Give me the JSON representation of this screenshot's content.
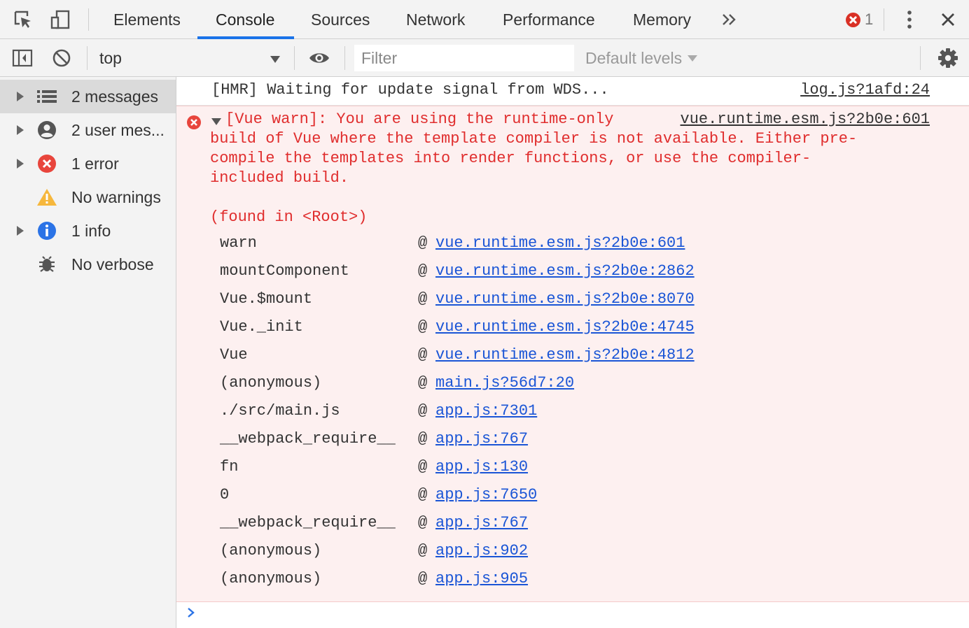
{
  "tabs": [
    {
      "label": "Elements"
    },
    {
      "label": "Console"
    },
    {
      "label": "Sources"
    },
    {
      "label": "Network"
    },
    {
      "label": "Performance"
    },
    {
      "label": "Memory"
    }
  ],
  "active_tab": "Console",
  "error_count": "1",
  "toolbar": {
    "context": "top",
    "filter_placeholder": "Filter",
    "levels": "Default levels"
  },
  "sidebar": {
    "items": [
      {
        "label": "2 messages",
        "icon": "list-icon"
      },
      {
        "label": "2 user mes...",
        "icon": "user-icon"
      },
      {
        "label": "1 error",
        "icon": "error-icon"
      },
      {
        "label": "No warnings",
        "icon": "warning-icon"
      },
      {
        "label": "1 info",
        "icon": "info-icon"
      },
      {
        "label": "No verbose",
        "icon": "bug-icon"
      }
    ]
  },
  "console": {
    "log": {
      "text": "[HMR] Waiting for update signal from WDS...",
      "source": "log.js?1afd:24"
    },
    "error": {
      "lines": [
        "[Vue warn]: You are using the runtime-only",
        "build of Vue where the template compiler is not available. Either pre-",
        "compile the templates into render functions, or use the compiler-",
        "included build."
      ],
      "found_in": "(found in <Root>)",
      "source": "vue.runtime.esm.js?2b0e:601",
      "stack": [
        {
          "fn": "warn",
          "link": "vue.runtime.esm.js?2b0e:601"
        },
        {
          "fn": "mountComponent",
          "link": "vue.runtime.esm.js?2b0e:2862"
        },
        {
          "fn": "Vue.$mount",
          "link": "vue.runtime.esm.js?2b0e:8070"
        },
        {
          "fn": "Vue._init",
          "link": "vue.runtime.esm.js?2b0e:4745"
        },
        {
          "fn": "Vue",
          "link": "vue.runtime.esm.js?2b0e:4812"
        },
        {
          "fn": "(anonymous)",
          "link": "main.js?56d7:20"
        },
        {
          "fn": "./src/main.js",
          "link": "app.js:7301"
        },
        {
          "fn": "__webpack_require__",
          "link": "app.js:767"
        },
        {
          "fn": "fn",
          "link": "app.js:130"
        },
        {
          "fn": "0",
          "link": "app.js:7650"
        },
        {
          "fn": "__webpack_require__",
          "link": "app.js:767"
        },
        {
          "fn": "(anonymous)",
          "link": "app.js:902"
        },
        {
          "fn": "(anonymous)",
          "link": "app.js:905"
        }
      ]
    }
  },
  "colors": {
    "accent": "#1a73e8",
    "error_text": "#e02d2d",
    "error_bg": "#fdf0f0",
    "link": "#1a55d6"
  }
}
